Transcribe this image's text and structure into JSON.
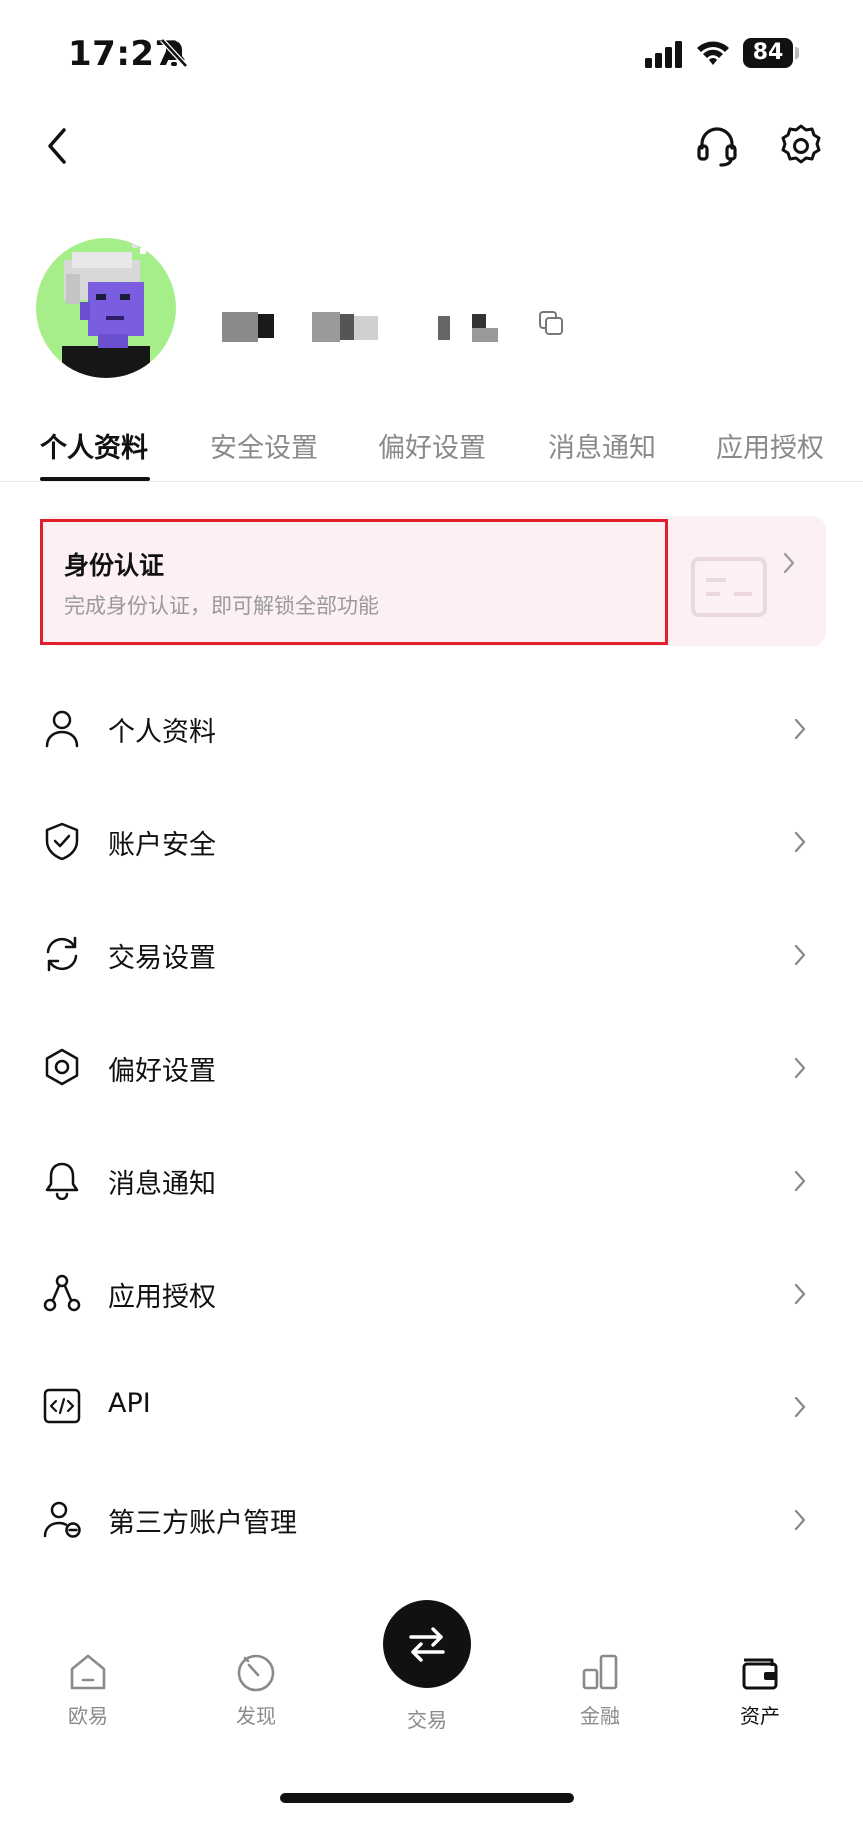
{
  "status_bar": {
    "time": "17:27",
    "battery": "84"
  },
  "profile": {
    "tabs": [
      "个人资料",
      "安全设置",
      "偏好设置",
      "消息通知",
      "应用授权"
    ],
    "active_tab": 0
  },
  "identity_verification": {
    "title": "身份认证",
    "subtitle": "完成身份认证，即可解锁全部功能"
  },
  "menu": [
    {
      "label": "个人资料",
      "icon": "person-icon"
    },
    {
      "label": "账户安全",
      "icon": "shield-check-icon"
    },
    {
      "label": "交易设置",
      "icon": "sync-icon"
    },
    {
      "label": "偏好设置",
      "icon": "hexagon-settings-icon"
    },
    {
      "label": "消息通知",
      "icon": "bell-icon"
    },
    {
      "label": "应用授权",
      "icon": "nodes-icon"
    },
    {
      "label": "API",
      "icon": "code-icon"
    },
    {
      "label": "第三方账户管理",
      "icon": "person-minus-icon"
    }
  ],
  "bottom_nav": [
    {
      "label": "欧易",
      "icon": "home-icon"
    },
    {
      "label": "发现",
      "icon": "discover-icon"
    },
    {
      "label": "交易",
      "icon": "swap-icon"
    },
    {
      "label": "金融",
      "icon": "finance-icon"
    },
    {
      "label": "资产",
      "icon": "wallet-icon"
    }
  ],
  "colors": {
    "accent_highlight": "#e0202a",
    "card_bg": "#fcf0f2",
    "avatar_bg": "#a6ee8a",
    "active": "#111111",
    "inactive": "#8a8a8a"
  }
}
